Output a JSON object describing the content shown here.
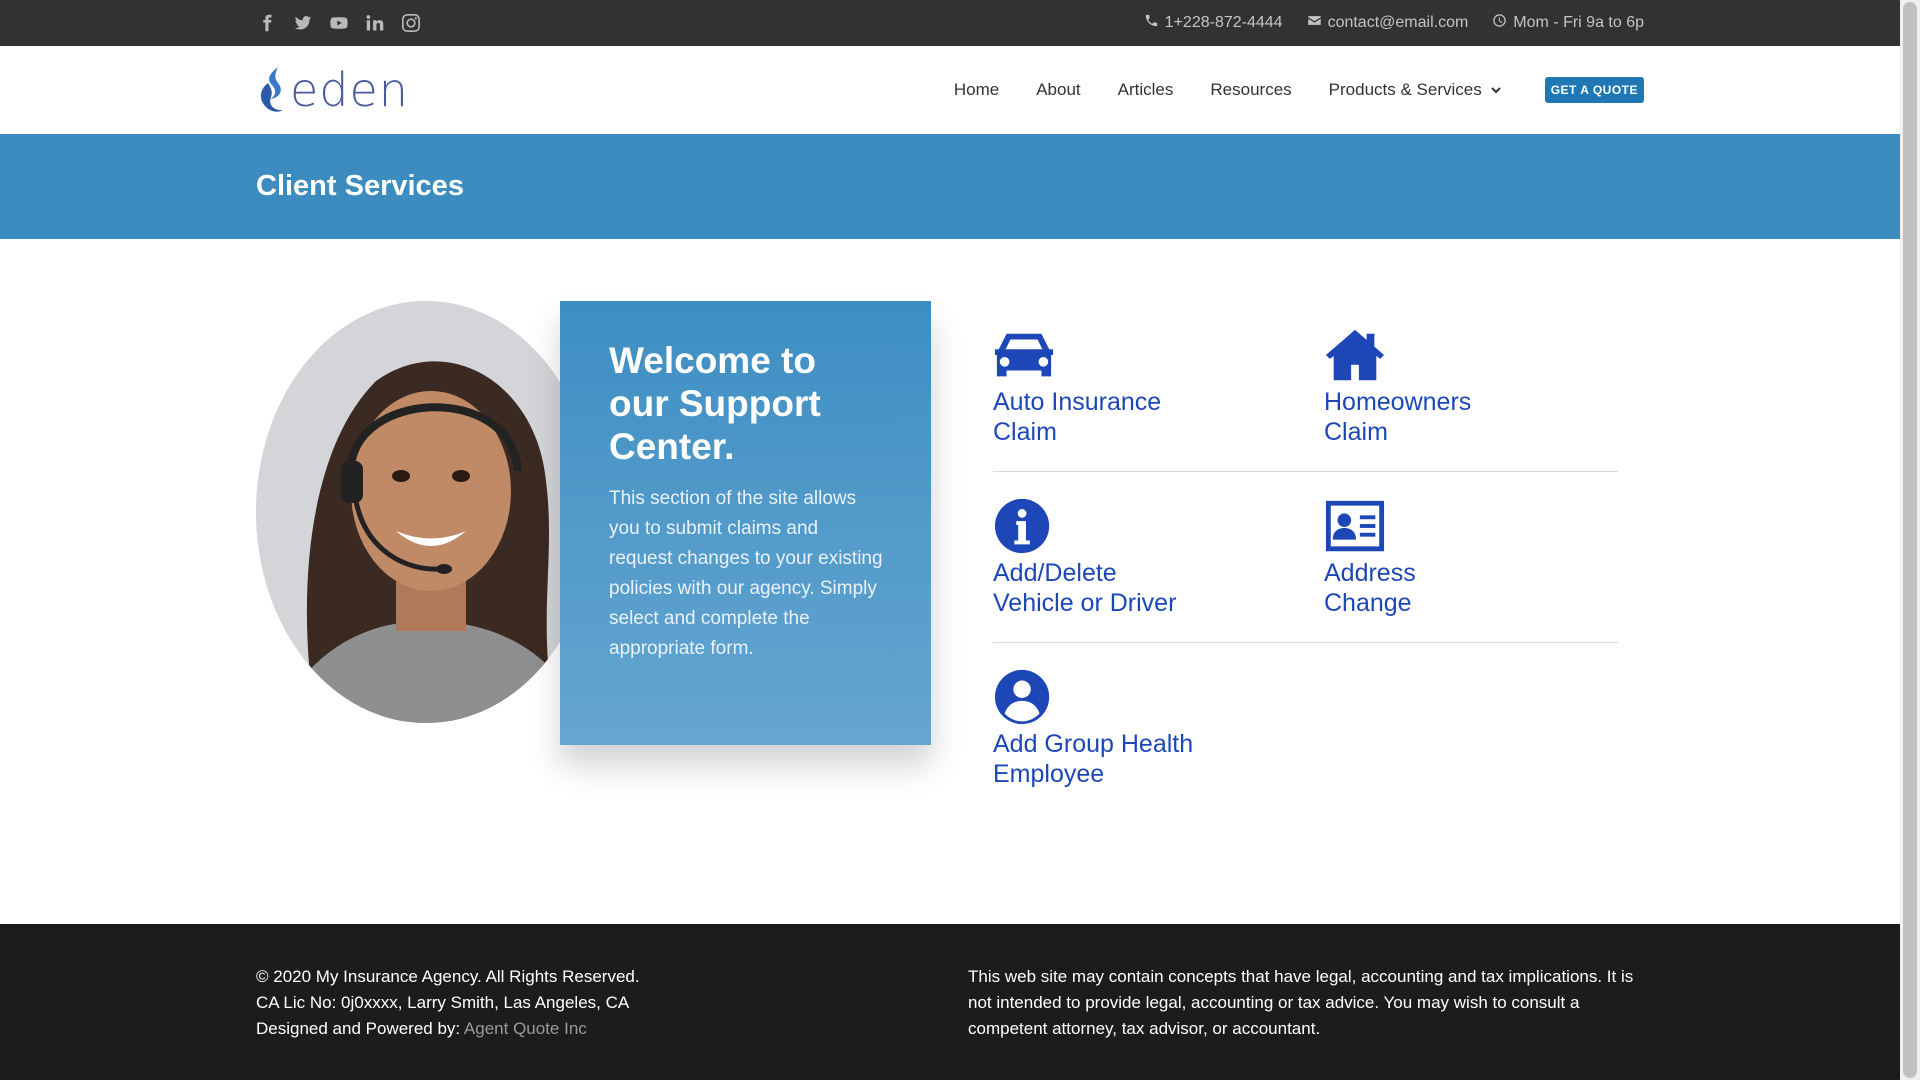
{
  "topbar": {
    "social": [
      "facebook-icon",
      "twitter-icon",
      "youtube-icon",
      "linkedin-icon",
      "instagram-icon"
    ],
    "phone": "1+228-872-4444",
    "email": "contact@email.com",
    "hours": "Mom - Fri 9a to 6p"
  },
  "header": {
    "logo_text": "eden",
    "nav": {
      "home": "Home",
      "about": "About",
      "articles": "Articles",
      "resources": "Resources",
      "products": "Products & Services"
    },
    "quote_button": "Get a Quote"
  },
  "banner": {
    "title": "Client Services"
  },
  "welcome": {
    "heading": "Welcome to our Support Center.",
    "body": "This section of the site allows you to submit claims and request changes to your existing policies with our agency. Simply select and complete the appropriate form."
  },
  "services": {
    "auto": {
      "line1": "Auto Insurance",
      "line2": "Claim",
      "icon": "car-icon"
    },
    "home": {
      "line1": "Homeowners",
      "line2": "Claim",
      "icon": "house-icon"
    },
    "vehicle": {
      "line1": "Add/Delete",
      "line2": "Vehicle or Driver",
      "icon": "info-icon"
    },
    "address": {
      "line1": "Address",
      "line2": "Change",
      "icon": "id-card-icon"
    },
    "health": {
      "line1": "Add Group Health",
      "line2": "Employee",
      "icon": "user-icon"
    }
  },
  "footer": {
    "copyright": "© 2020 My Insurance Agency. All Rights Reserved.",
    "license": "CA Lic No: 0j0xxxx, Larry Smith, Las Angeles, CA",
    "designed_prefix": "Designed and Powered by: ",
    "designed_link": "Agent Quote Inc",
    "disclaimer": "This web site may contain concepts that have legal, accounting and tax implications. It is not intended to provide legal, accounting or tax advice. You may wish to consult a competent attorney, tax advisor, or accountant."
  },
  "colors": {
    "topbar": "#323232",
    "banner": "#3d8cbf",
    "accent_blue": "#1d47b7",
    "footer": "#1c1c1c"
  }
}
